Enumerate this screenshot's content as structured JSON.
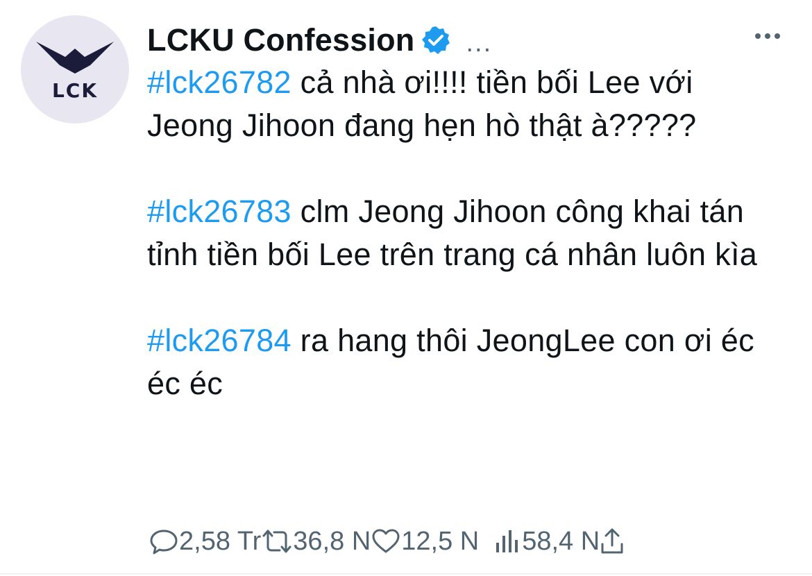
{
  "account": {
    "display_name": "LCKU Confession",
    "avatar_text": "LCK",
    "verified": true,
    "ellipsis": "..."
  },
  "tweet": {
    "paragraphs": [
      {
        "hashtag": "#lck26782",
        "text": " cả nhà ơi!!!! tiền bối Lee với Jeong Jihoon đang hẹn hò thật à?????"
      },
      {
        "hashtag": "#lck26783",
        "text": " clm Jeong Jihoon công khai tán tỉnh tiền bối Lee trên trang cá nhân luôn kìa"
      },
      {
        "hashtag": "#lck26784",
        "text": " ra hang thôi JeongLee con ơi éc éc éc"
      }
    ]
  },
  "actions": {
    "replies": "2,58 Tr",
    "retweets": "36,8 N",
    "likes": "12,5 N",
    "views": "58,4 N"
  },
  "colors": {
    "accent": "#1d9bf0",
    "muted": "#536471",
    "text": "#0f1419",
    "avatar_bg": "#e8e7f1"
  },
  "icons": [
    "verified-badge-icon",
    "more-options-icon",
    "reply-icon",
    "retweet-icon",
    "like-icon",
    "views-icon",
    "share-icon"
  ]
}
